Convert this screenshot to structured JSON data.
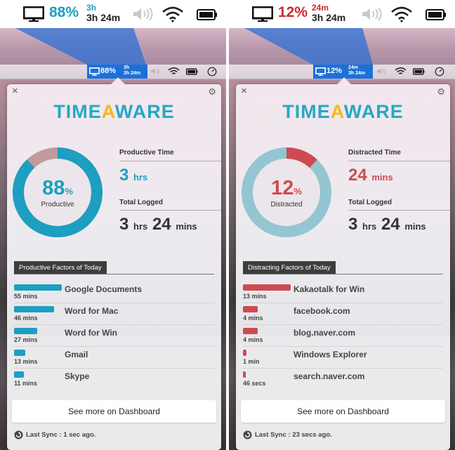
{
  "panels": [
    {
      "id": "productive",
      "percent": "88%",
      "time_short": "3h",
      "time_logged": "3h 24m",
      "menubar_percent": "88%",
      "menubar_time_short": "3h",
      "menubar_time_logged": "3h 24m",
      "accent_color": "#1c9fc0",
      "ring_fill_color": "#1c9fc0",
      "ring_rest_color": "#c29a9c",
      "ring_fraction": 0.88,
      "ring_inner_color": "#ebe6eb",
      "logo_left": "TIME",
      "logo_a": "A",
      "logo_right": "WARE",
      "donut_pct_number": "88",
      "donut_pct_sign": "%",
      "donut_label": "Productive",
      "stat_label": "Productive Time",
      "stat_number": "3",
      "stat_unit": "hrs",
      "total_label": "Total Logged",
      "total_hours": "3",
      "total_hours_unit": "hrs",
      "total_mins": "24",
      "total_mins_unit": "mins",
      "section_title": "Productive Factors of Today",
      "factors": [
        {
          "time": "55 mins",
          "name": "Google Documents",
          "minutes": 55
        },
        {
          "time": "46 mins",
          "name": "Word for Mac",
          "minutes": 46
        },
        {
          "time": "27 mins",
          "name": "Word for Win",
          "minutes": 27
        },
        {
          "time": "13 mins",
          "name": "Gmail",
          "minutes": 13
        },
        {
          "time": "11 mins",
          "name": "Skype",
          "minutes": 11
        }
      ],
      "dashboard_label": "See more on Dashboard",
      "sync_text": "Last Sync : 1 sec ago."
    },
    {
      "id": "distracted",
      "percent": "12%",
      "time_short": "24m",
      "time_logged": "3h 24m",
      "menubar_percent": "12%",
      "menubar_time_short": "24m",
      "menubar_time_logged": "3h 24m",
      "accent_color": "#cd4b50",
      "ring_fill_color": "#cd4b50",
      "ring_rest_color": "#93c6d1",
      "ring_fraction": 0.12,
      "ring_inner_color": "#ebe6eb",
      "logo_left": "TIME",
      "logo_a": "A",
      "logo_right": "WARE",
      "donut_pct_number": "12",
      "donut_pct_sign": "%",
      "donut_label": "Distracted",
      "stat_label": "Distracted Time",
      "stat_number": "24",
      "stat_unit": "mins",
      "total_label": "Total Logged",
      "total_hours": "3",
      "total_hours_unit": "hrs",
      "total_mins": "24",
      "total_mins_unit": "mins",
      "section_title": "Distracting Factors of Today",
      "factors": [
        {
          "time": "13 mins",
          "name": "Kakaotalk for Win",
          "minutes": 13
        },
        {
          "time": "4 mins",
          "name": "facebook.com",
          "minutes": 4
        },
        {
          "time": "4 mins",
          "name": "blog.naver.com",
          "minutes": 4
        },
        {
          "time": "1 min",
          "name": "Windows Explorer",
          "minutes": 1
        },
        {
          "time": "46 secs",
          "name": "search.naver.com",
          "minutes": 0.77
        }
      ],
      "dashboard_label": "See more on Dashboard",
      "sync_text": "Last Sync : 23 secs ago."
    }
  ],
  "icons": {
    "monitor": "monitor-icon",
    "volume": "volume-icon",
    "wifi": "wifi-icon",
    "battery": "battery-icon",
    "clock": "clock-icon",
    "close": "close-icon",
    "gear": "gear-icon",
    "sync": "sync-icon"
  },
  "close_glyph": "×",
  "gear_glyph": "⚙"
}
